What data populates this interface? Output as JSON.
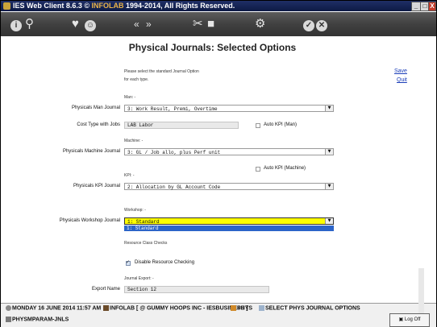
{
  "window": {
    "title_prefix": "IES Web Client 8.6.3 ©",
    "title_infolab": "INFOLAB",
    "title_suffix": "1994-2014, All Rights Reserved.",
    "controls": {
      "minimize": "_",
      "maximize": "□",
      "close": "X"
    }
  },
  "toolbar": {
    "icons": [
      "info-icon",
      "search-icon",
      "heart-icon",
      "smiley-icon",
      "rewind-icon",
      "fast-forward-icon",
      "tools-icon",
      "stop-icon",
      "settings-icon",
      "check-icon",
      "cancel-icon"
    ]
  },
  "page": {
    "title": "Physical Journals: Selected Options",
    "instruction_line1": "Please select the standard Journal Option",
    "instruction_line2": "for each type.",
    "save_label": "Save",
    "quit_label": "Quit"
  },
  "form": {
    "man_section": "Man: -",
    "man_journal_label": "Physicals Man Journal",
    "man_journal_value": "3: Work Result, Premi, Overtime",
    "cost_type_label": "Cost Type with Jobs",
    "cost_type_value": "LAB Labor",
    "auto_kpi_man_label": "Auto KPI (Man)",
    "auto_kpi_man_checked": false,
    "machine_section": "Machine: -",
    "machine_journal_label": "Physicals Machine Journal",
    "machine_journal_value": "3: GL / Job allo, plus Perf unit",
    "auto_kpi_machine_label": "Auto KPI (Machine)",
    "auto_kpi_machine_checked": false,
    "kpi_section": "KPI: -",
    "kpi_journal_label": "Physicals KPI Journal",
    "kpi_journal_value": "2: Allocation by GL Account Code",
    "workshop_section": "Workshop: -",
    "workshop_journal_label": "Physicals Workshop Journal",
    "workshop_journal_value": "1: Standard",
    "workshop_dropdown_option": "1: Standard",
    "resource_section": "Resource Class Checks",
    "disable_resource_label": "Disable Resource Checking",
    "disable_resource_checked": true,
    "journal_export_section": "Journal Export: -",
    "export_name_label": "Export Name",
    "export_name_value": "Section 12"
  },
  "taskbar": {
    "date": "MONDAY 16 JUNE 2014 11:57 AM",
    "company": "INFOLAB [ @ GUMMY HOOPS INC - IESBUSINESS ]",
    "module": "PHYS",
    "screen": "SELECT PHYS JOURNAL OPTIONS",
    "program": "PHYSMPARAM-JNLS",
    "logoff": "Log Off"
  },
  "colors": {
    "titlebar": "#0d1a44",
    "toolbar": "#404040",
    "highlight_select": "#fefe00",
    "dropdown_selected": "#2c64c8",
    "link": "#1a3db8"
  }
}
